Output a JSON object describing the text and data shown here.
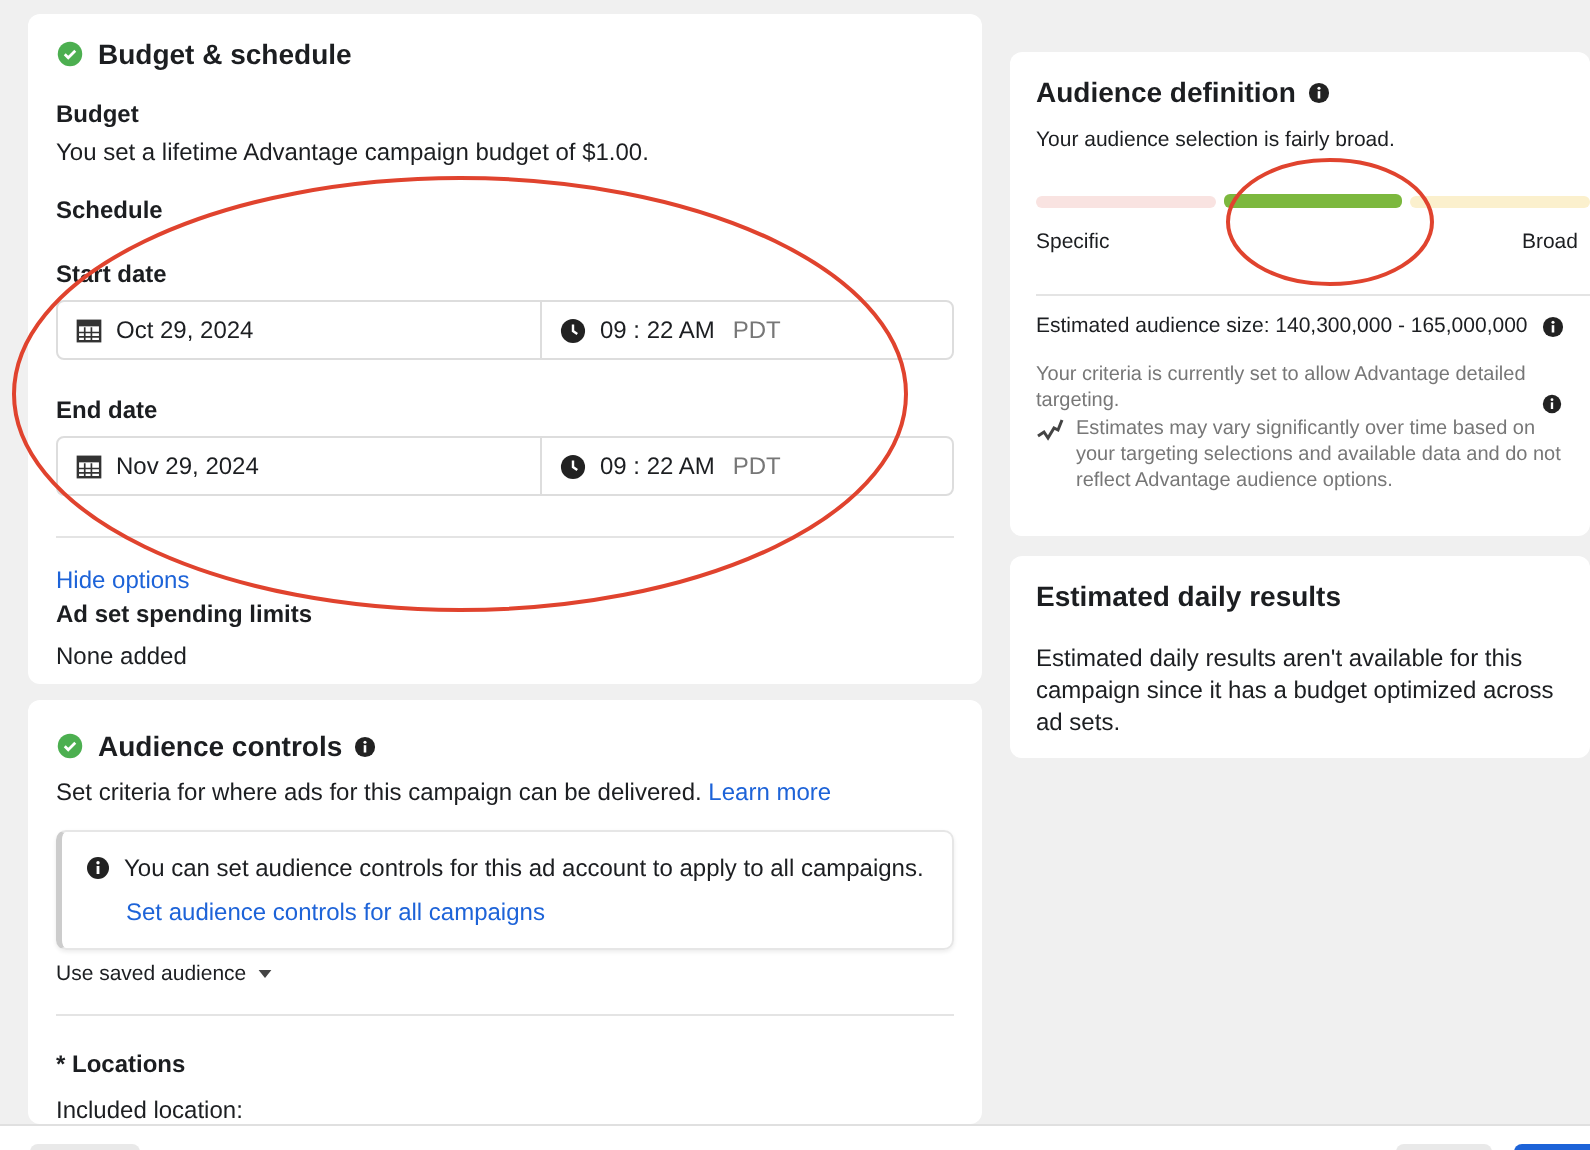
{
  "budget_schedule": {
    "title": "Budget & schedule",
    "complete": true,
    "budget_label": "Budget",
    "budget_text": "You set a lifetime Advantage campaign budget of $1.00.",
    "schedule_label": "Schedule",
    "dates": [
      {
        "label": "Start date",
        "date": "Oct 29, 2024",
        "time": "09 : 22 AM",
        "zone": "PDT"
      },
      {
        "label": "End date",
        "date": "Nov 29, 2024",
        "time": "09 : 22 AM",
        "zone": "PDT"
      }
    ],
    "hide_options": "Hide options",
    "limits_label": "Ad set spending limits",
    "limits_value": "None added"
  },
  "audience_controls": {
    "title": "Audience controls",
    "complete": true,
    "description": "Set criteria for where ads for this campaign can be delivered.",
    "learn_more": "Learn more",
    "notice": {
      "text": "You can set audience controls for this ad account to apply to all campaigns.",
      "link": "Set audience controls for all campaigns"
    },
    "saved_audience": "Use saved audience",
    "locations_label": "* Locations",
    "included_label": "Included location:"
  },
  "audience_definition": {
    "title": "Audience definition",
    "summary": "Your audience selection is fairly broad.",
    "segments": [
      {
        "color": "#f9e3e1",
        "selected": false
      },
      {
        "color": "#7cb83e",
        "selected": true
      },
      {
        "color": "#fbf0cd",
        "selected": false
      }
    ],
    "left_label": "Specific",
    "right_label": "Broad",
    "size": "Estimated audience size: 140,300,000 - 165,000,000",
    "criteria": "Your criteria is currently set to allow Advantage detailed targeting.",
    "estimates_note": "Estimates may vary significantly over time based on your targeting selections and available data and do not reflect Advantage audience options."
  },
  "daily_results": {
    "title": "Estimated daily results",
    "text": "Estimated daily results aren't available for this campaign since it has a budget optimized across ad sets."
  }
}
